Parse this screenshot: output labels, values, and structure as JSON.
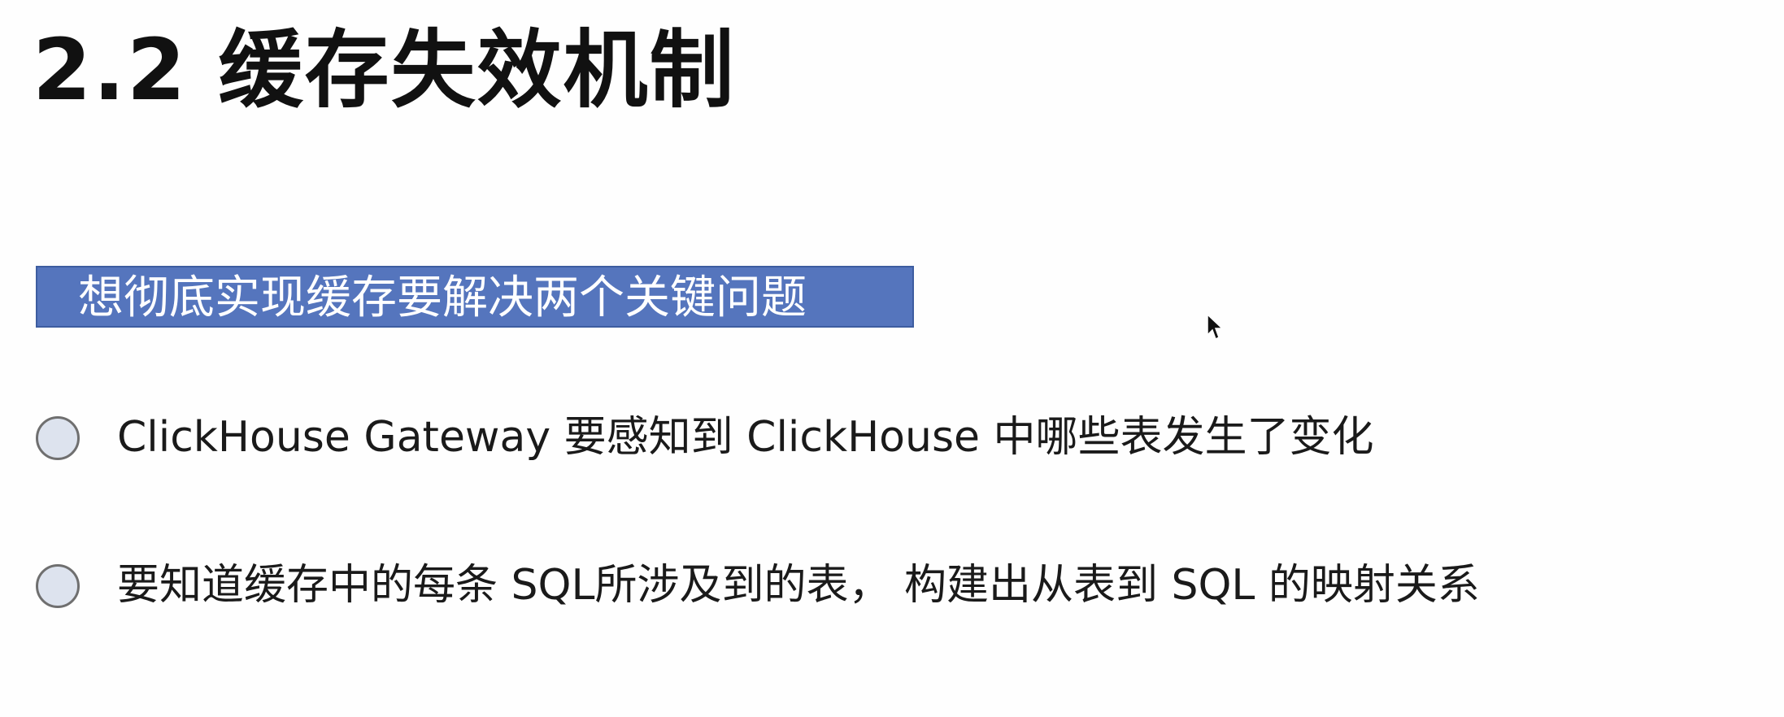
{
  "slide": {
    "title": "2.2 缓存失效机制",
    "banner": {
      "text": "想彻底实现缓存要解决两个关键问题",
      "color": "#5575bd"
    },
    "bullets": [
      {
        "text": "ClickHouse Gateway 要感知到 ClickHouse 中哪些表发生了变化"
      },
      {
        "text": "要知道缓存中的每条 SQL所涉及到的表， 构建出从表到 SQL 的映射关系"
      }
    ]
  }
}
